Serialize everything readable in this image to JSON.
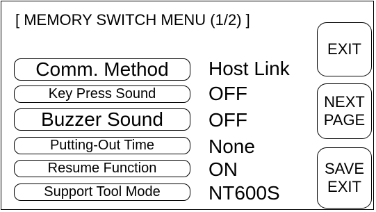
{
  "menu": {
    "title": "[ MEMORY SWITCH MENU (1/2) ]"
  },
  "items": [
    {
      "label": "Comm. Method",
      "value": "Host Link"
    },
    {
      "label": "Key Press Sound",
      "value": "OFF"
    },
    {
      "label": "Buzzer Sound",
      "value": "OFF"
    },
    {
      "label": "Putting-Out Time",
      "value": "None"
    },
    {
      "label": "Resume Function",
      "value": "ON"
    },
    {
      "label": "Support Tool Mode",
      "value": "NT600S"
    }
  ],
  "side_buttons": {
    "exit": {
      "label": "EXIT"
    },
    "next_page": {
      "line1": "NEXT",
      "line2": "PAGE"
    },
    "save_exit": {
      "line1": "SAVE",
      "line2": "EXIT"
    }
  }
}
